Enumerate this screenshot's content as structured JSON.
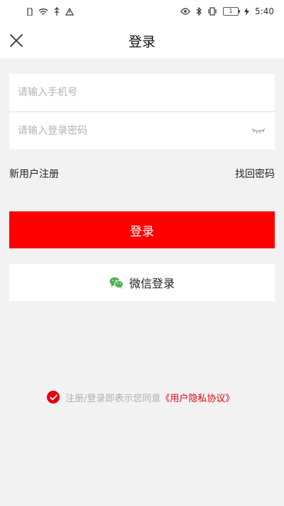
{
  "status_bar": {
    "time": "5:40",
    "battery_level": "1",
    "left_icons": [
      "sim-card-icon",
      "wifi-icon",
      "usb-icon",
      "warning-icon"
    ],
    "right_icons": [
      "eye-icon",
      "bluetooth-icon",
      "vibrate-icon",
      "battery-icon",
      "charging-icon"
    ]
  },
  "header": {
    "title": "登录",
    "close_icon": "close-icon"
  },
  "form": {
    "phone_placeholder": "请输入手机号",
    "phone_value": "",
    "password_placeholder": "请输入登录密码",
    "password_value": "",
    "password_visibility_icon": "eye-closed-icon"
  },
  "links": {
    "register": "新用户注册",
    "forgot_password": "找回密码"
  },
  "buttons": {
    "login": "登录",
    "wechat_login": "微信登录",
    "wechat_icon": "wechat-icon"
  },
  "agreement": {
    "checked": true,
    "text": "注册/登录即表示您同意",
    "link": "《用户隐私协议》"
  },
  "colors": {
    "primary": "#ff0000",
    "agreement_link": "#e60012",
    "background": "#f2f2f2",
    "wechat_green": "#4caf50"
  }
}
